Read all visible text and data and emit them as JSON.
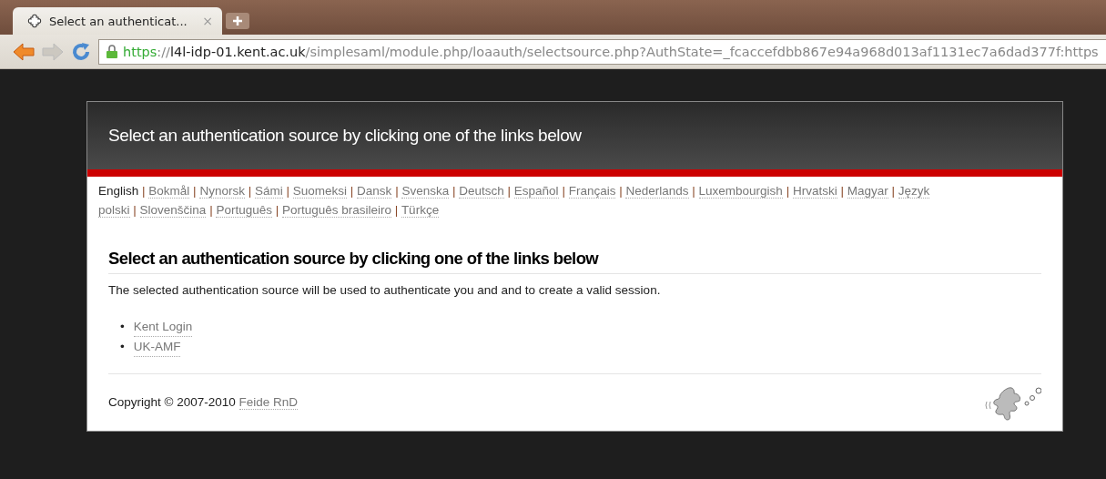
{
  "browser": {
    "tabs": [
      {
        "title": "Select an authenticat...",
        "close": "×",
        "selected": true
      }
    ],
    "address": {
      "scheme": "https",
      "separator": "://",
      "host": "l4l-idp-01.kent.ac.uk",
      "path": "/simplesaml/module.php/loaauth/selectsource.php?AuthState=_fcaccefdbb867e94a968d013af1131ec7a6dad377f:https"
    }
  },
  "header": {
    "title": "Select an authentication source by clicking one of the links below"
  },
  "languages": {
    "separator": "|",
    "items": [
      {
        "label": "English",
        "selected": true
      },
      {
        "label": "Bokmål",
        "selected": false
      },
      {
        "label": "Nynorsk",
        "selected": false
      },
      {
        "label": "Sámi",
        "selected": false
      },
      {
        "label": "Suomeksi",
        "selected": false
      },
      {
        "label": "Dansk",
        "selected": false
      },
      {
        "label": "Svenska",
        "selected": false
      },
      {
        "label": "Deutsch",
        "selected": false
      },
      {
        "label": "Español",
        "selected": false
      },
      {
        "label": "Français",
        "selected": false
      },
      {
        "label": "Nederlands",
        "selected": false
      },
      {
        "label": "Luxembourgish",
        "selected": false
      },
      {
        "label": "Hrvatski",
        "selected": false
      },
      {
        "label": "Magyar",
        "selected": false
      },
      {
        "label_parts": [
          "Język",
          "polski"
        ],
        "selected": false
      },
      {
        "label": "Slovenščina",
        "selected": false
      },
      {
        "label": "Português",
        "selected": false
      },
      {
        "label": "Português brasileiro",
        "selected": false
      },
      {
        "label": "Türkçe",
        "selected": false
      }
    ]
  },
  "content": {
    "heading": "Select an authentication source by clicking one of the links below",
    "description": "The selected authentication source will be used to authenticate you and and to create a valid session.",
    "bullet": "•",
    "sources": [
      "Kent Login",
      "UK-AMF"
    ]
  },
  "footer": {
    "copyright": "Copyright © 2007-2010",
    "link": "Feide RnD"
  }
}
